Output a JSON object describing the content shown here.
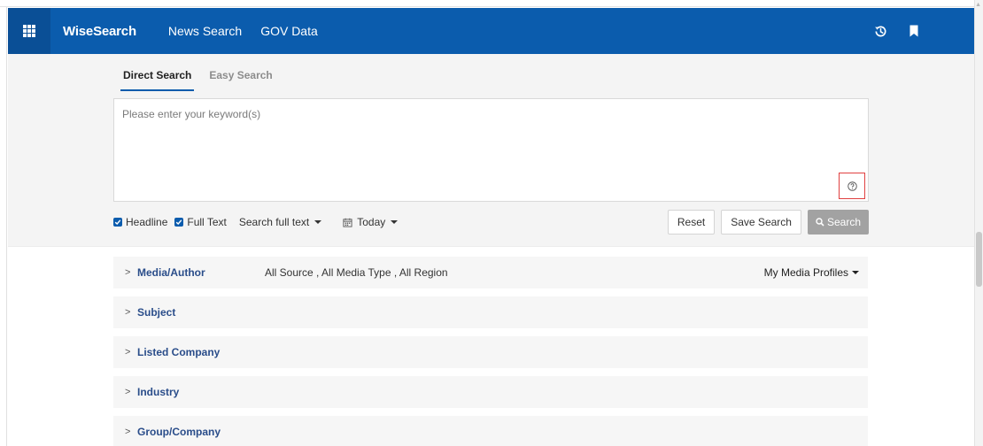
{
  "navbar": {
    "brand": "WiseSearch",
    "links": [
      "News Search",
      "GOV Data"
    ],
    "icons": [
      "history-icon",
      "bookmark-icon"
    ],
    "color": "#0b5cad"
  },
  "tabs": [
    {
      "label": "Direct Search",
      "active": true
    },
    {
      "label": "Easy Search",
      "active": false
    }
  ],
  "keyword": {
    "placeholder": "Please enter your keyword(s)",
    "value": ""
  },
  "options": {
    "headline_label": "Headline",
    "headline_checked": true,
    "fulltext_label": "Full Text",
    "fulltext_checked": true,
    "scope_label": "Search full text",
    "date_label": "Today"
  },
  "buttons": {
    "reset": "Reset",
    "save": "Save Search",
    "search": "Search"
  },
  "filters": [
    {
      "label": "Media/Author",
      "summary": "All Source , All Media Type , All Region",
      "extra": "My Media Profiles"
    },
    {
      "label": "Subject",
      "summary": "",
      "extra": ""
    },
    {
      "label": "Listed Company",
      "summary": "",
      "extra": ""
    },
    {
      "label": "Industry",
      "summary": "",
      "extra": ""
    },
    {
      "label": "Group/Company",
      "summary": "",
      "extra": ""
    }
  ],
  "colors": {
    "accent": "#0b5cad",
    "help_highlight": "#e04040",
    "filter_label": "#2a4d8a"
  }
}
